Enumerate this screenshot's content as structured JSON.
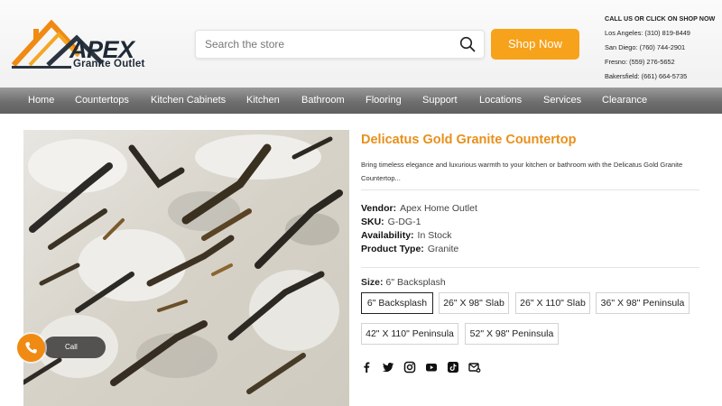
{
  "header": {
    "logo": {
      "name": "APEX",
      "subtitle": "Granite Outlet"
    },
    "search": {
      "placeholder": "Search the store"
    },
    "shop_button": "Shop Now",
    "contact": {
      "title": "CALL US OR CLICK ON SHOP NOW",
      "lines": [
        "Los Angeles: (310) 819-8449",
        "San Diego: (760) 744-2901",
        "Fresno: (559) 276-5652",
        "Bakersfield: (661) 664-5735"
      ]
    }
  },
  "nav": {
    "items": [
      "Home",
      "Countertops",
      "Kitchen Cabinets",
      "Kitchen",
      "Bathroom",
      "Flooring",
      "Support",
      "Locations",
      "Services",
      "Clearance"
    ]
  },
  "call_widget": {
    "label": "Call"
  },
  "product": {
    "title": "Delicatus Gold Granite Countertop",
    "description": "Bring timeless elegance and luxurious warmth to your kitchen or bathroom with the Delicatus Gold Granite Countertop...",
    "meta": [
      {
        "label": "Vendor:",
        "value": "Apex Home Outlet"
      },
      {
        "label": "SKU:",
        "value": "G-DG-1"
      },
      {
        "label": "Availability:",
        "value": "In Stock"
      },
      {
        "label": "Product Type:",
        "value": "Granite"
      }
    ],
    "size": {
      "label": "Size:",
      "selected": "6\" Backsplash",
      "options": [
        "6\" Backsplash",
        "26\" X 98\" Slab",
        "26\" X 110\" Slab",
        "36\" X 98\" Peninsula",
        "42\" X 110\" Peninsula",
        "52\" X 98\" Peninsula"
      ]
    },
    "social_icons": [
      "facebook-icon",
      "twitter-icon",
      "instagram-icon",
      "youtube-icon",
      "tiktok-icon",
      "email-icon"
    ]
  },
  "colors": {
    "accent": "#f7a21b",
    "title": "#e8901a",
    "nav": "#6f6f6f"
  }
}
